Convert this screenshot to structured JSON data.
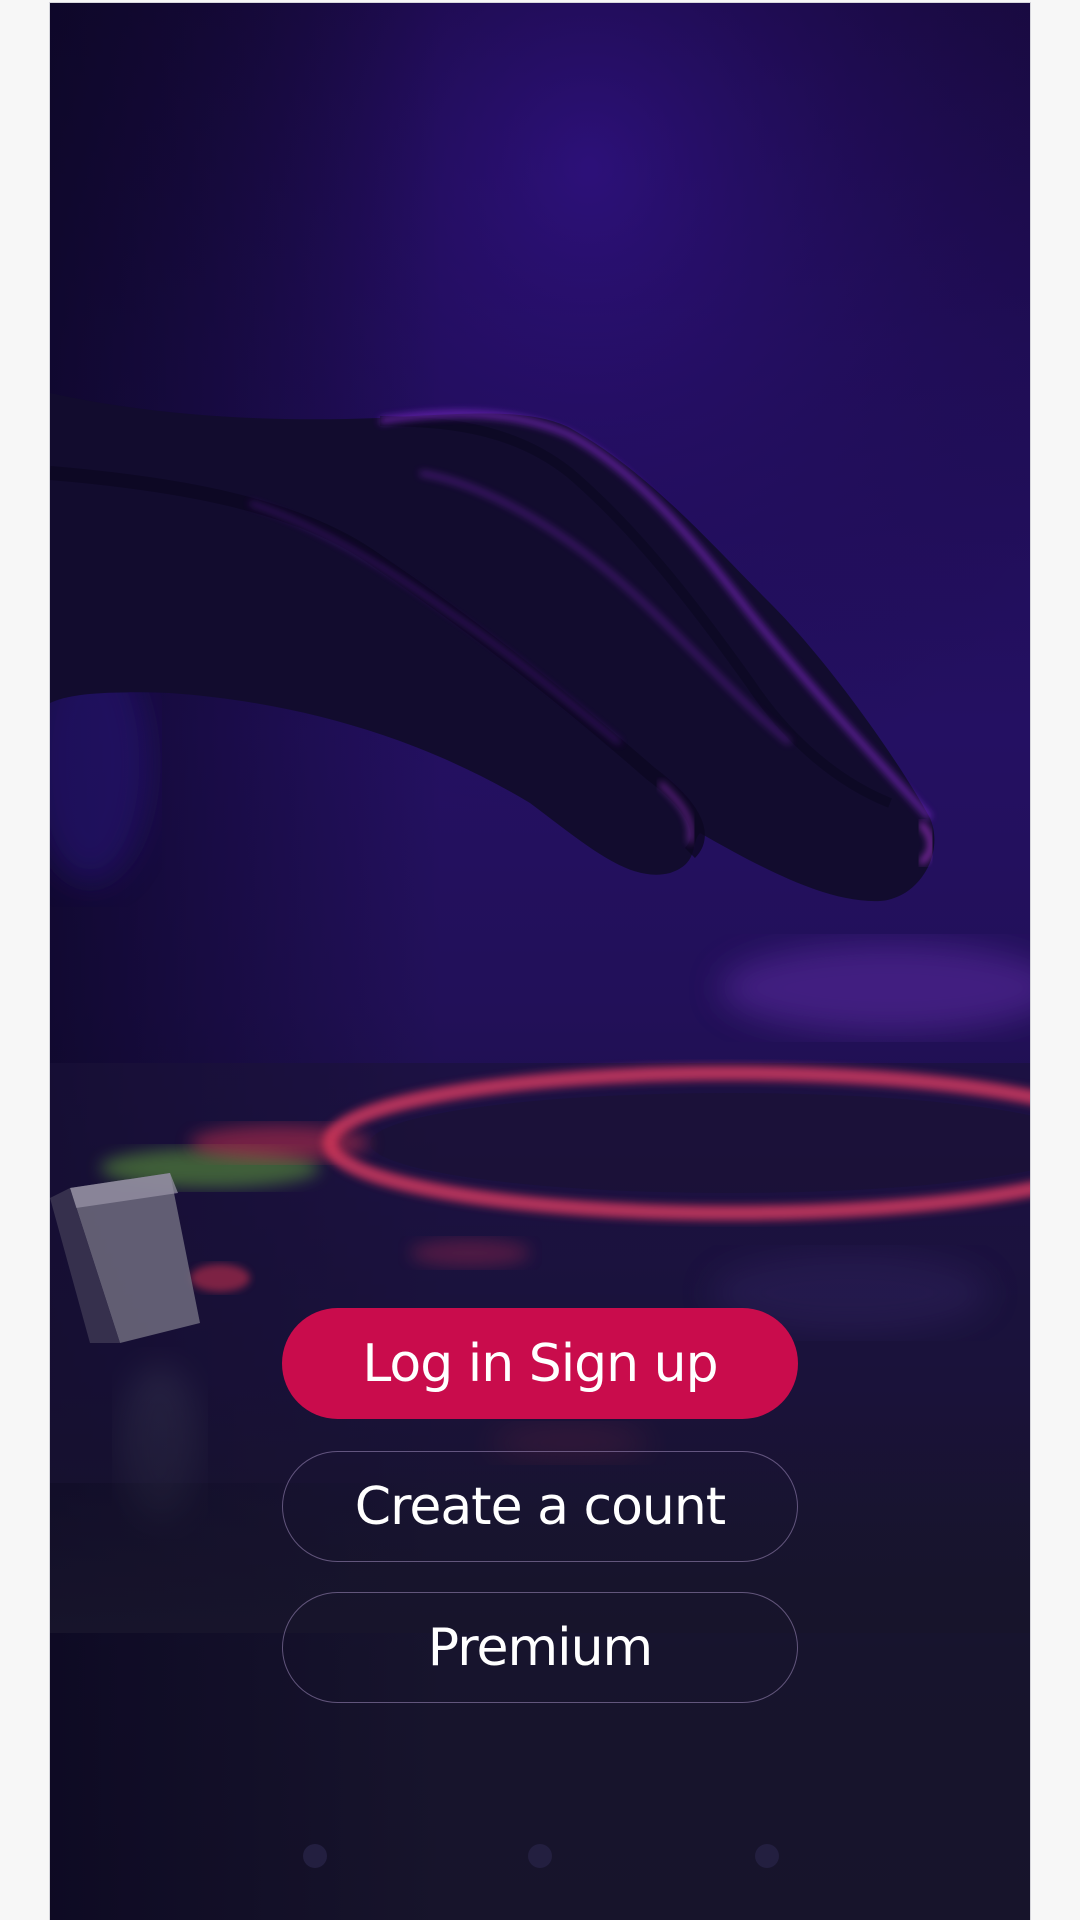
{
  "buttons": {
    "login_label": "Log in Sign up",
    "create_account_label": "Create a count",
    "premium_label": "Premium"
  },
  "pager": {
    "pages": 3
  },
  "colors": {
    "primary": "#c90c4c",
    "background": "#17142b",
    "accent_purple": "#5a1fbf"
  },
  "icons": {
    "hero": "dj-hand-turntable-image"
  }
}
